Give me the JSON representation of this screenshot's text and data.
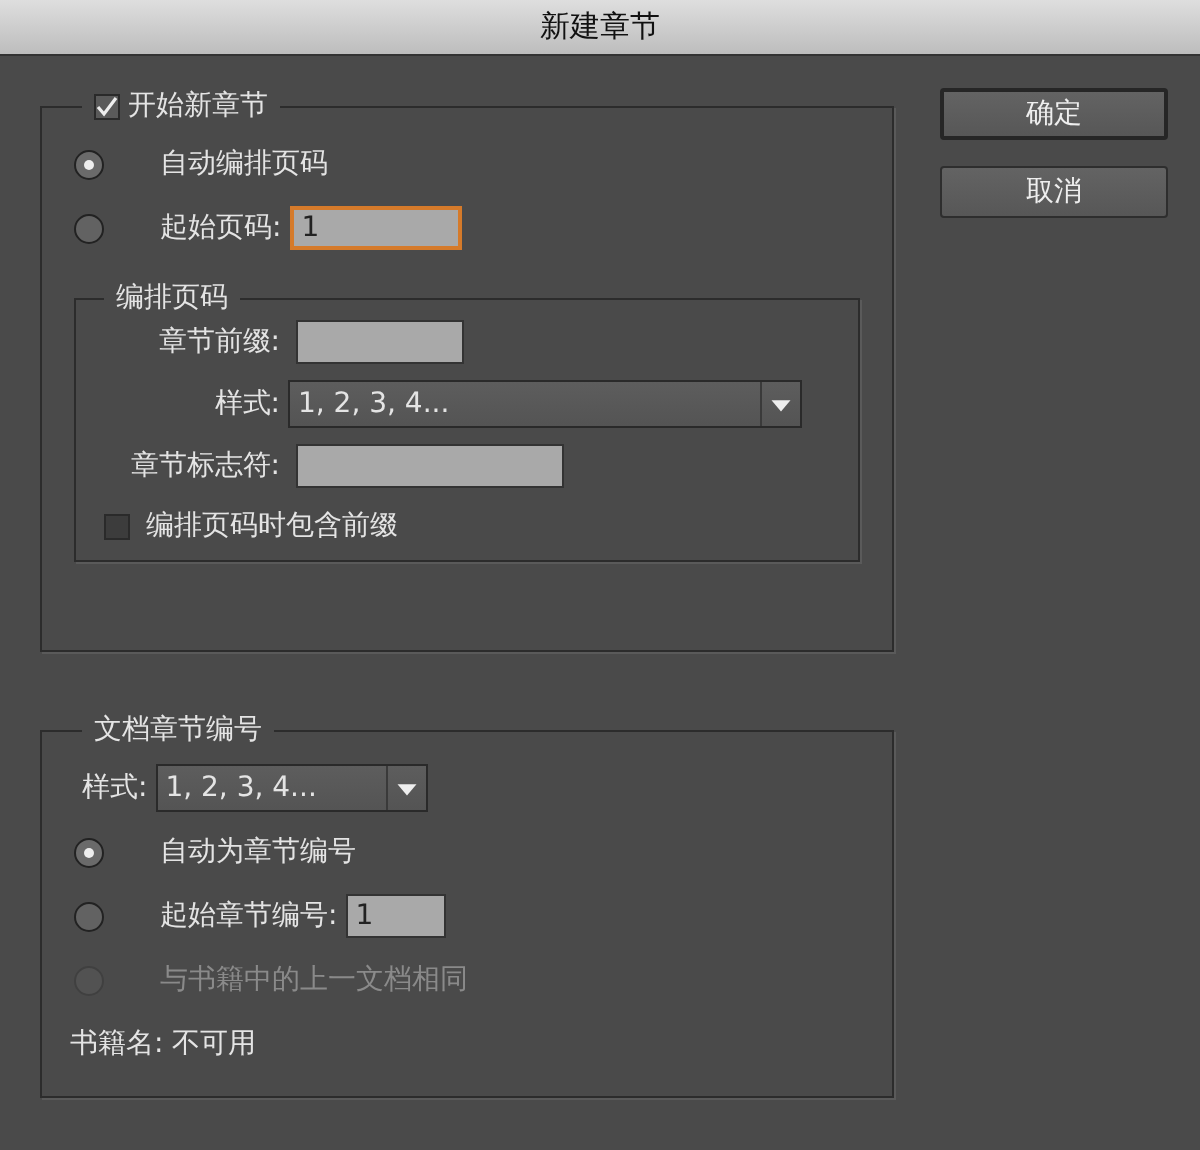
{
  "window": {
    "title": "新建章节"
  },
  "new_section": {
    "label": "开始新章节",
    "checked": true,
    "radios": [
      {
        "kind": "plain",
        "label": "自动编排页码",
        "selected": true
      },
      {
        "kind": "field",
        "label": "起始页码:",
        "value": "1",
        "focused": true,
        "selected": false
      }
    ],
    "page_numbering": {
      "title": "编排页码",
      "prefix_label": "章节前缀:",
      "style_label": "样式:",
      "style_value": "1, 2, 3, 4...",
      "marker_label": "章节标志符:",
      "include_prefix": {
        "label": "编排页码时包含前缀",
        "checked": false
      }
    }
  },
  "document_chapter": {
    "title": "文档章节编号",
    "style_label": "样式:",
    "style_value": "1, 2, 3, 4...",
    "radios": [
      {
        "kind": "plain",
        "label": "自动为章节编号",
        "selected": true,
        "disabled": false
      },
      {
        "kind": "field",
        "label": "起始章节编号:",
        "value": "1",
        "focused": false,
        "selected": false,
        "disabled": false
      },
      {
        "kind": "plain",
        "label": "与书籍中的上一文档相同",
        "selected": false,
        "disabled": true
      }
    ],
    "book_name": "书籍名: 不可用"
  },
  "buttons": [
    {
      "label": "确定",
      "default": true
    },
    {
      "label": "取消",
      "default": false
    }
  ]
}
